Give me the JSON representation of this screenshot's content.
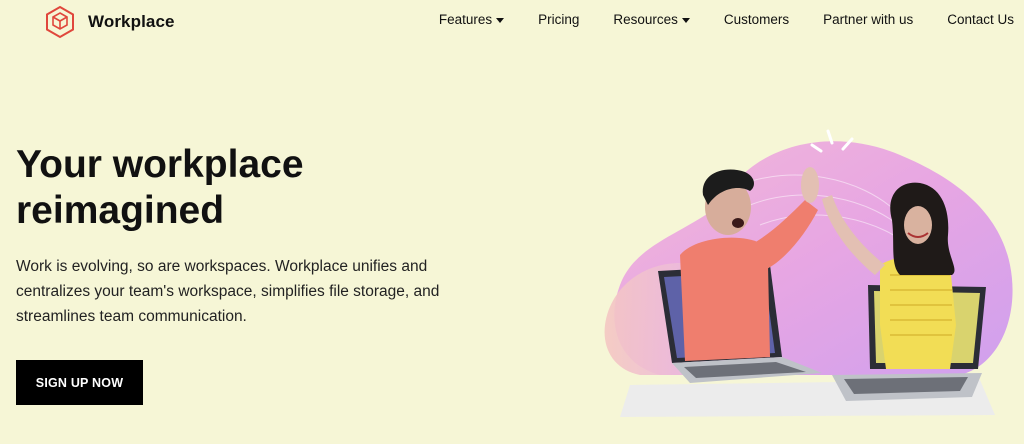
{
  "brand": {
    "name": "Workplace",
    "logo_icon": "cube-logo-icon",
    "accent_color": "#e0473c"
  },
  "nav": {
    "items": [
      {
        "label": "Features",
        "has_dropdown": true
      },
      {
        "label": "Pricing",
        "has_dropdown": false
      },
      {
        "label": "Resources",
        "has_dropdown": true
      },
      {
        "label": "Customers",
        "has_dropdown": false
      },
      {
        "label": "Partner with us",
        "has_dropdown": false
      },
      {
        "label": "Contact Us",
        "has_dropdown": false
      }
    ]
  },
  "hero": {
    "title_line1": "Your workplace",
    "title_line2": "reimagined",
    "subtitle": "Work is evolving, so are workspaces. Workplace unifies and centralizes your team's workspace, simplifies file storage, and streamlines team communication.",
    "cta_label": "SIGN UP NOW"
  },
  "colors": {
    "background": "#f6f6d6",
    "cta_bg": "#000000",
    "cta_text": "#ffffff"
  }
}
